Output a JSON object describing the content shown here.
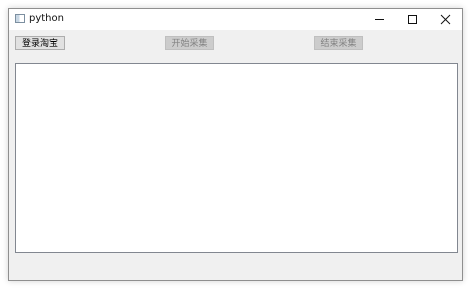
{
  "window": {
    "title": "python"
  },
  "toolbar": {
    "login_label": "登录淘宝",
    "start_label": "开始采集",
    "stop_label": "结束采集"
  },
  "icons": {
    "app": "app-icon",
    "minimize": "minimize-icon",
    "maximize": "maximize-icon",
    "close": "close-icon"
  },
  "colors": {
    "window_bg": "#f0f0f0",
    "titlebar_bg": "#ffffff",
    "disabled_button_bg": "#cccccc",
    "disabled_text": "#838383"
  }
}
